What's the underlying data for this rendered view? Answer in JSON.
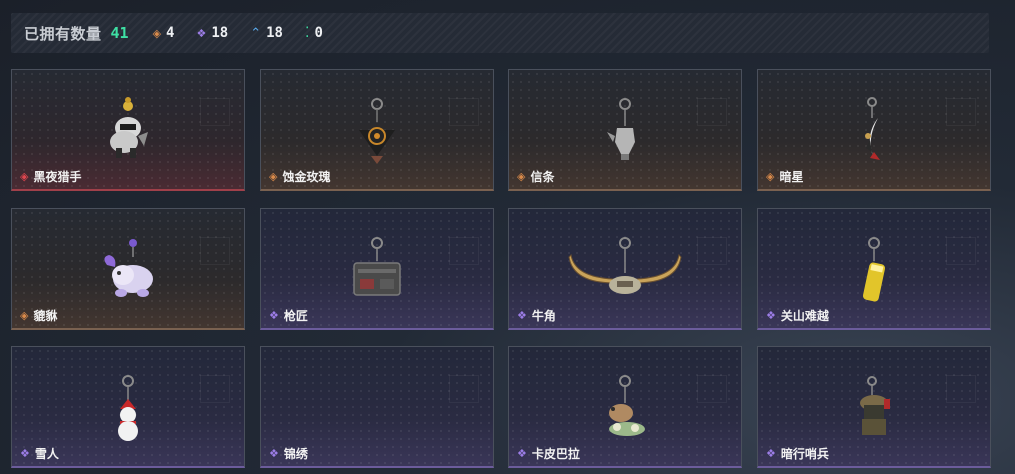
{
  "header": {
    "label": "已拥有数量",
    "total": "41",
    "stats": [
      {
        "icon": "orange-diamond-icon",
        "value": "4",
        "color": "#d98a4a",
        "glyph": "◈"
      },
      {
        "icon": "purple-diamond-icon",
        "value": "18",
        "color": "#9d7ee8",
        "glyph": "❖"
      },
      {
        "icon": "blue-chevron-icon",
        "value": "18",
        "color": "#5aa8e8",
        "glyph": "⌃"
      },
      {
        "icon": "green-dots-icon",
        "value": "0",
        "color": "#3ee0a4",
        "glyph": "⁚"
      }
    ]
  },
  "items": [
    {
      "name": "黑夜猎手",
      "rarity": "red"
    },
    {
      "name": "蚀金玫瑰",
      "rarity": "orange"
    },
    {
      "name": "信条",
      "rarity": "orange"
    },
    {
      "name": "暗星",
      "rarity": "orange"
    },
    {
      "name": "貔貅",
      "rarity": "orange"
    },
    {
      "name": "枪匠",
      "rarity": "purple"
    },
    {
      "name": "牛角",
      "rarity": "purple"
    },
    {
      "name": "关山难越",
      "rarity": "purple"
    },
    {
      "name": "雪人",
      "rarity": "purple"
    },
    {
      "name": "锦绣",
      "rarity": "purple"
    },
    {
      "name": "卡皮巴拉",
      "rarity": "purple"
    },
    {
      "name": "暗行哨兵",
      "rarity": "purple"
    }
  ]
}
